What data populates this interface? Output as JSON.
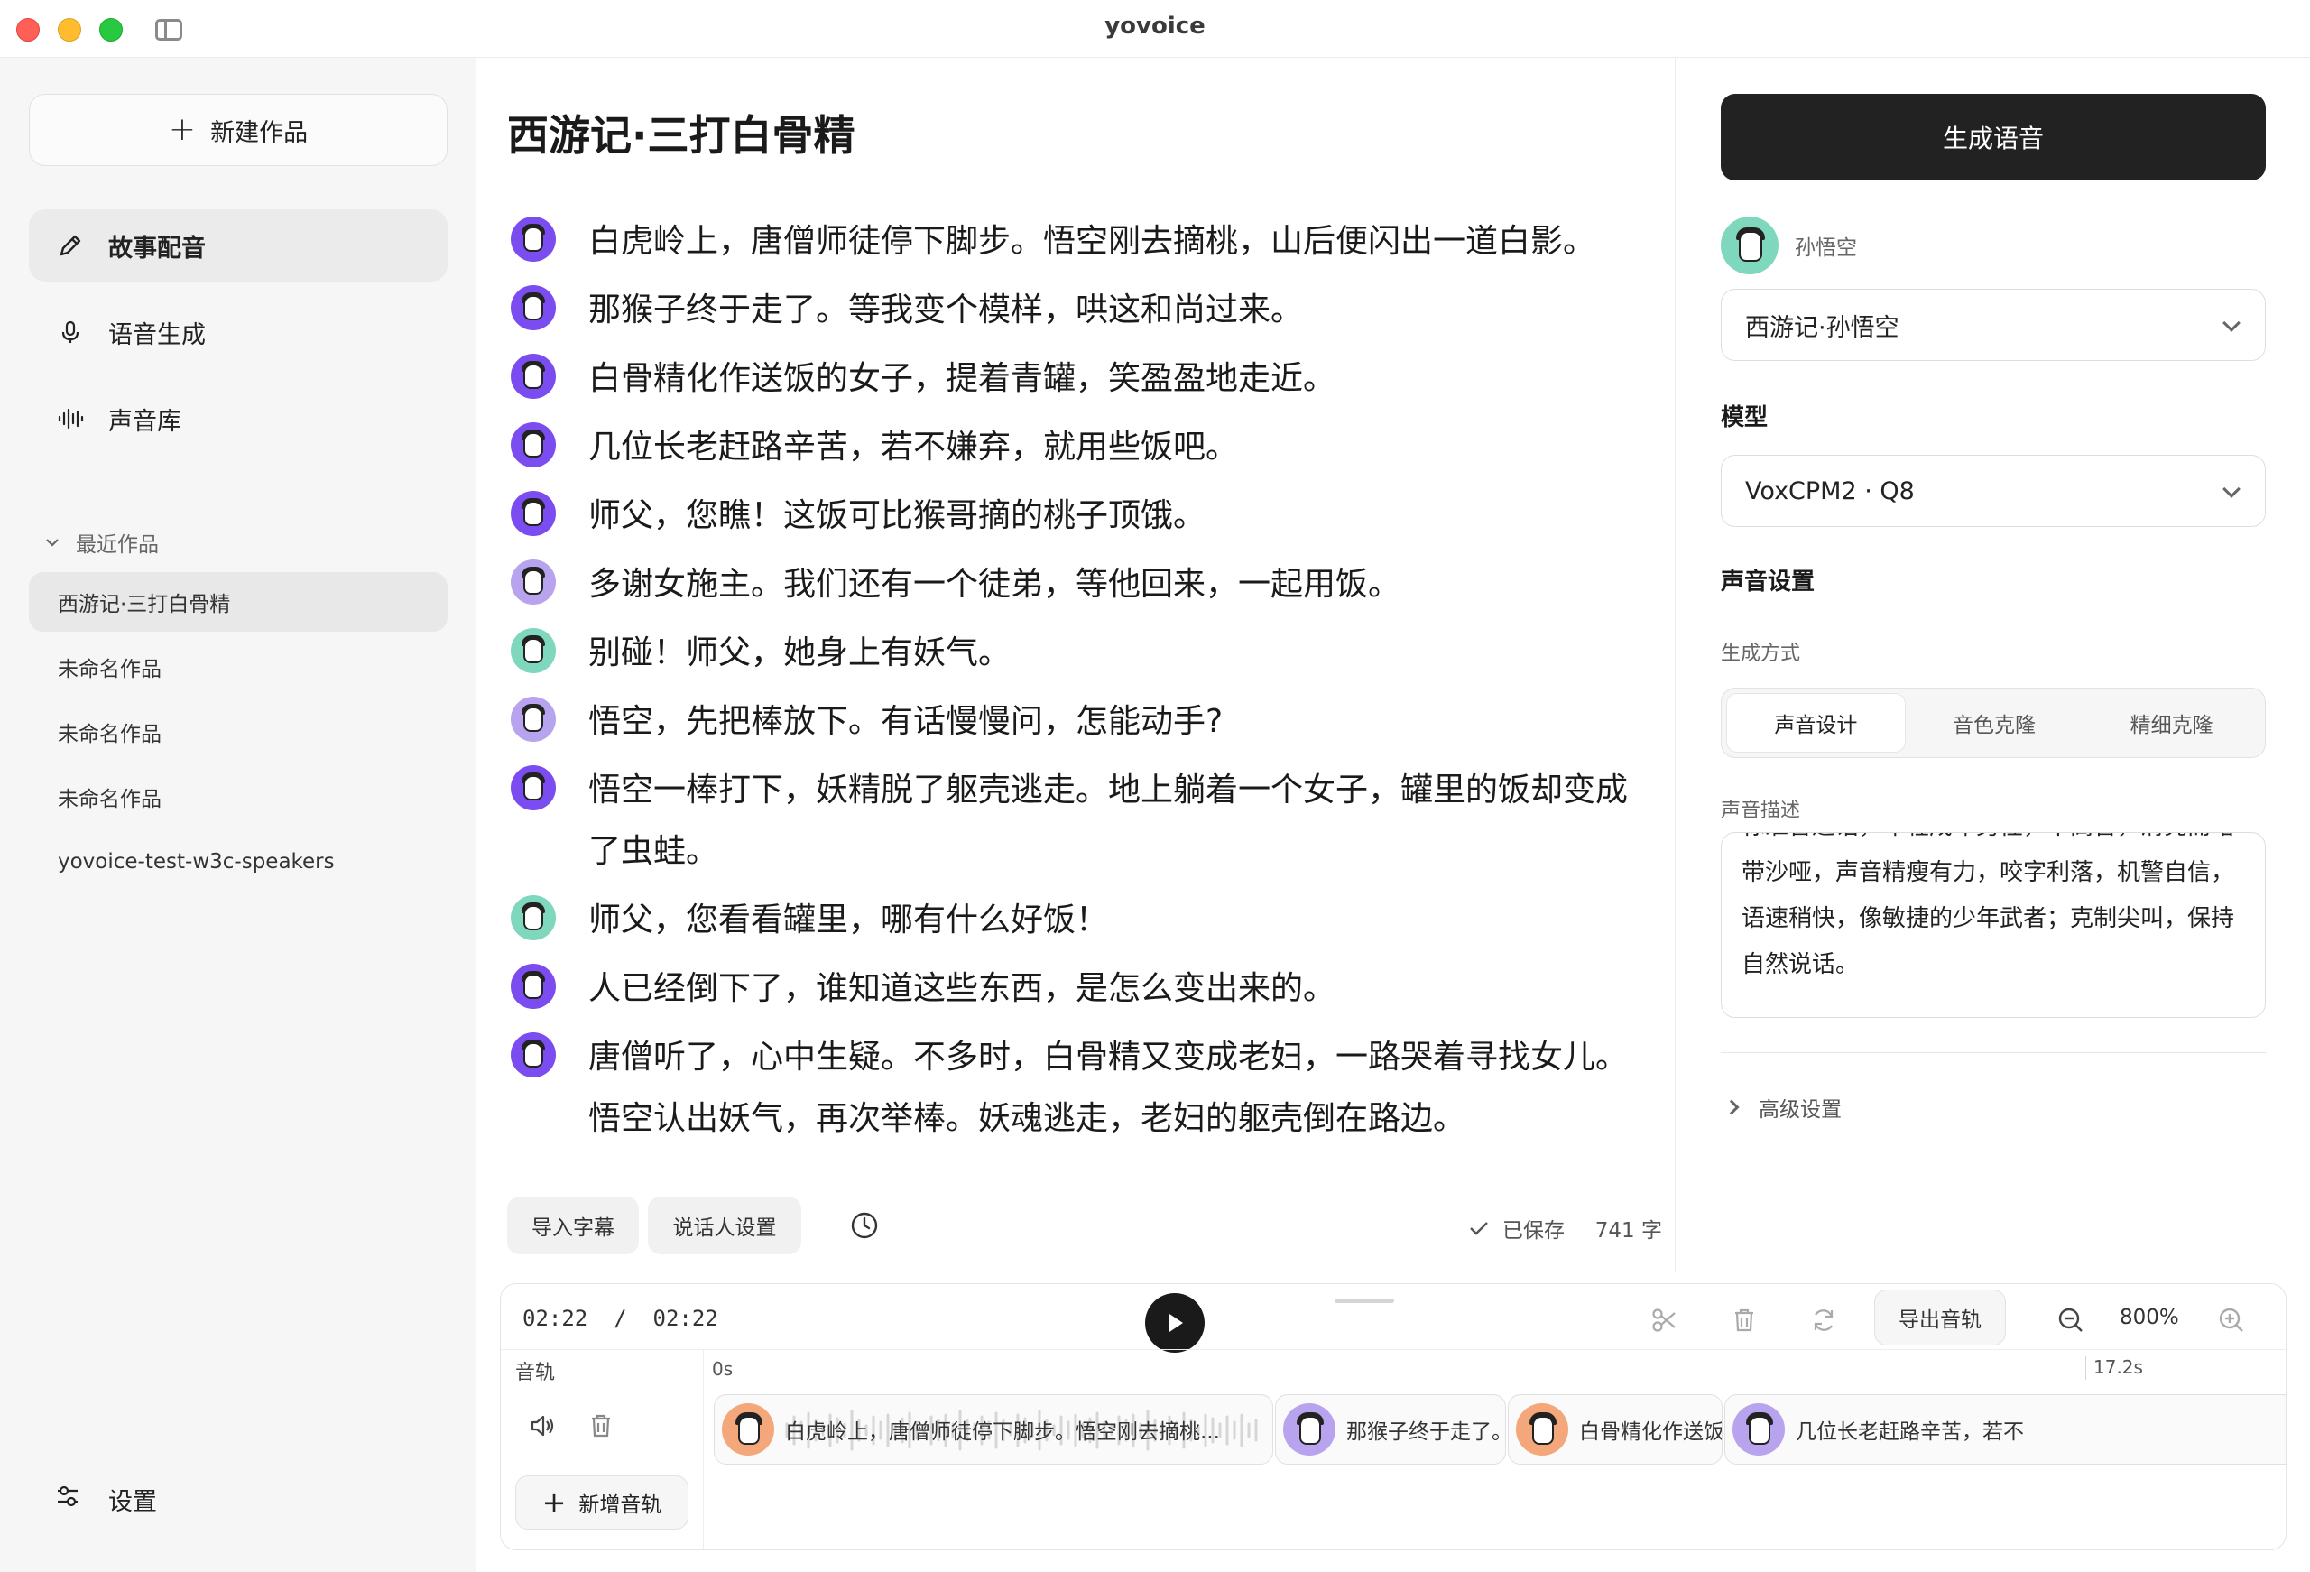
{
  "app": {
    "title": "yovoice"
  },
  "sidebar": {
    "new_label": "新建作品",
    "nav": [
      {
        "label": "故事配音",
        "icon": "pencil-icon",
        "active": true
      },
      {
        "label": "语音生成",
        "icon": "microphone-icon",
        "active": false
      },
      {
        "label": "声音库",
        "icon": "waveform-icon",
        "active": false
      }
    ],
    "recent_header": "最近作品",
    "recent": [
      {
        "label": "西游记·三打白骨精",
        "active": true
      },
      {
        "label": "未命名作品",
        "active": false
      },
      {
        "label": "未命名作品",
        "active": false
      },
      {
        "label": "未命名作品",
        "active": false
      },
      {
        "label": "yovoice-test-w3c-speakers",
        "active": false
      }
    ],
    "settings_label": "设置"
  },
  "editor": {
    "title": "西游记·三打白骨精",
    "lines": [
      {
        "text": "白虎岭上，唐僧师徒停下脚步。悟空刚去摘桃，山后便闪出一道白影。",
        "avatar": "purple"
      },
      {
        "text": "那猴子终于走了。等我变个模样，哄这和尚过来。",
        "avatar": "purple"
      },
      {
        "text": "白骨精化作送饭的女子，提着青罐，笑盈盈地走近。",
        "avatar": "purple"
      },
      {
        "text": "几位长老赶路辛苦，若不嫌弃，就用些饭吧。",
        "avatar": "purple"
      },
      {
        "text": "师父，您瞧！这饭可比猴哥摘的桃子顶饿。",
        "avatar": "purple"
      },
      {
        "text": "多谢女施主。我们还有一个徒弟，等他回来，一起用饭。",
        "avatar": "lilac"
      },
      {
        "text": "别碰！师父，她身上有妖气。",
        "avatar": "teal"
      },
      {
        "text": "悟空，先把棒放下。有话慢慢问，怎能动手?",
        "avatar": "lilac"
      },
      {
        "text": "悟空一棒打下，妖精脱了躯壳逃走。地上躺着一个女子，罐里的饭却变成了虫蛙。",
        "avatar": "purple"
      },
      {
        "text": "师父，您看看罐里，哪有什么好饭！",
        "avatar": "teal"
      },
      {
        "text": "人已经倒下了，谁知道这些东西，是怎么变出来的。",
        "avatar": "purple"
      },
      {
        "text": "唐僧听了，心中生疑。不多时，白骨精又变成老妇，一路哭着寻找女儿。悟空认出妖气，再次举棒。妖魂逃走，老妇的躯壳倒在路边。",
        "avatar": "purple"
      }
    ],
    "toolbar": {
      "import_label": "导入字幕",
      "speaker_label": "说话人设置",
      "saved_label": "已保存",
      "char_count": "741 字"
    }
  },
  "right_panel": {
    "generate_label": "生成语音",
    "speaker_name": "孙悟空",
    "voice_select": "西游记·孙悟空",
    "model_label": "模型",
    "model_select": "VoxCPM2 · Q8",
    "voice_settings_label": "声音设置",
    "gen_mode_label": "生成方式",
    "modes": [
      {
        "label": "声音设计",
        "active": true
      },
      {
        "label": "音色克隆",
        "active": false
      },
      {
        "label": "精细克隆",
        "active": false
      }
    ],
    "desc_label": "声音描述",
    "desc_text": "标准普通话，年轻成年男性，中高音，清亮而略带沙哑，声音精瘦有力，咬字利落，机警自信，语速稍快，像敏捷的少年武者；克制尖叫，保持自然说话。",
    "advanced_label": "高级设置"
  },
  "timeline": {
    "current_time": "02:22",
    "total_time": "02:22",
    "export_label": "导出音轨",
    "zoom": "800%",
    "track_label": "音轨",
    "ruler_start": "0s",
    "ruler_end": "17.2s",
    "add_track_label": "新增音轨",
    "clips": [
      {
        "text": "白虎岭上，唐僧师徒停下脚步。悟空刚去摘桃...",
        "avatar": "peach"
      },
      {
        "text": "那猴子终于走了。等我变个...",
        "avatar": "lilac"
      },
      {
        "text": "白骨精化作送饭的女子，...",
        "avatar": "peach"
      },
      {
        "text": "几位长老赶路辛苦，若不",
        "avatar": "lilac"
      }
    ]
  },
  "colors": {
    "accent_dark": "#222222",
    "avatar_purple": "#7b4cf0",
    "avatar_lilac": "#b8a3ee",
    "avatar_teal": "#7fd7bd",
    "avatar_peach": "#f4a77a"
  }
}
